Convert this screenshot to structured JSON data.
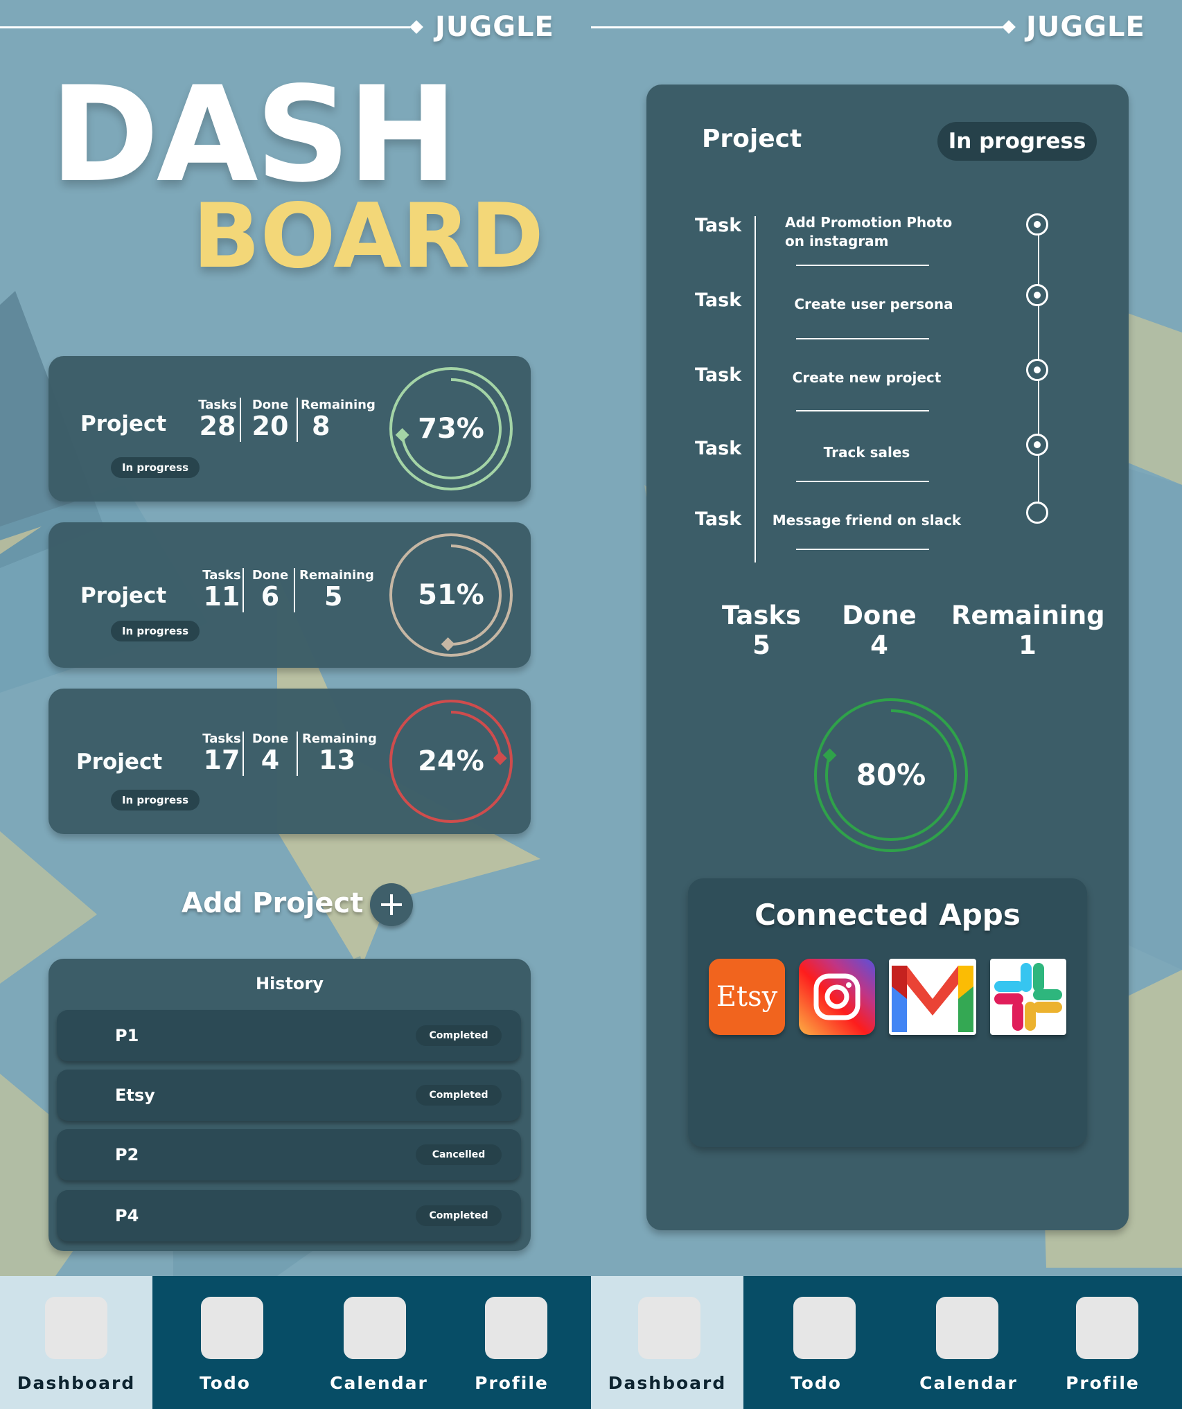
{
  "brand": "JUGGLE",
  "title": {
    "line1": "DASH",
    "line2": "BOARD"
  },
  "projects": [
    {
      "name": "Project",
      "status": "In progress",
      "tasks_label": "Tasks",
      "done_label": "Done",
      "remaining_label": "Remaining",
      "tasks": "28",
      "done": "20",
      "remaining": "8",
      "percent_label": "73%",
      "progress": 0.73,
      "color": "#a6d6a6"
    },
    {
      "name": "Project",
      "status": "In progress",
      "tasks_label": "Tasks",
      "done_label": "Done",
      "remaining_label": "Remaining",
      "tasks": "11",
      "done": "6",
      "remaining": "5",
      "percent_label": "51%",
      "progress": 0.51,
      "color": "#c9b8a4"
    },
    {
      "name": "Project",
      "status": "In progress",
      "tasks_label": "Tasks",
      "done_label": "Done",
      "remaining_label": "Remaining",
      "tasks": "17",
      "done": "4",
      "remaining": "13",
      "percent_label": "24%",
      "progress": 0.24,
      "color": "#d24a4a"
    }
  ],
  "add_project": {
    "label": "Add Project"
  },
  "history": {
    "title": "History",
    "rows": [
      {
        "name": "P1",
        "status": "Completed"
      },
      {
        "name": "Etsy",
        "status": "Completed"
      },
      {
        "name": "P2",
        "status": "Cancelled"
      },
      {
        "name": "P4",
        "status": "Completed"
      }
    ]
  },
  "nav": {
    "items": [
      {
        "label": "Dashboard",
        "active": true
      },
      {
        "label": "Todo"
      },
      {
        "label": "Calendar"
      },
      {
        "label": "Profile"
      }
    ]
  },
  "detail": {
    "title": "Project",
    "status": "In progress",
    "task_label": "Task",
    "tasks": [
      {
        "text": "Add Promotion Photo on instagram",
        "done": true
      },
      {
        "text": "Create user persona",
        "done": true
      },
      {
        "text": "Create new project",
        "done": true
      },
      {
        "text": "Track sales",
        "done": true
      },
      {
        "text": "Message friend on slack",
        "done": false
      }
    ],
    "stats": {
      "tasks_label": "Tasks",
      "tasks": "5",
      "done_label": "Done",
      "done": "4",
      "remaining_label": "Remaining",
      "remaining": "1"
    },
    "percent_label": "80%",
    "progress": 0.8,
    "ring_color": "#2fa24a"
  },
  "connected_apps": {
    "title": "Connected Apps",
    "apps": [
      {
        "name": "Etsy",
        "icon": "etsy-icon"
      },
      {
        "name": "Instagram",
        "icon": "instagram-icon"
      },
      {
        "name": "Gmail",
        "icon": "gmail-icon"
      },
      {
        "name": "Slack",
        "icon": "slack-icon"
      }
    ]
  }
}
